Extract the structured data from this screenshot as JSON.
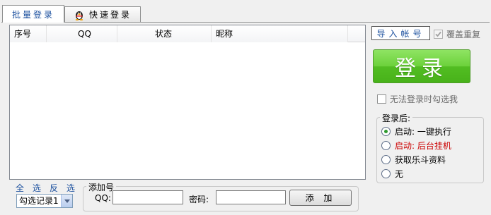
{
  "tabs": [
    {
      "label": "批量登录",
      "active": true
    },
    {
      "label": "快速登录",
      "active": false,
      "icon": "qq-penguin-icon"
    }
  ],
  "list": {
    "columns": [
      "序号",
      "QQ",
      "状态",
      "昵称"
    ]
  },
  "select": {
    "all_label": "全 选",
    "invert_label": "反 选",
    "combo_value": "勾选记录1"
  },
  "add_group": {
    "title": "添加号",
    "qq_label": "QQ:",
    "password_label": "密码:",
    "qq_value": "",
    "password_value": "",
    "add_button": "添 加"
  },
  "import_button": "导入帐号",
  "overwrite_checkbox": {
    "label": "覆盖重复",
    "checked": true,
    "disabled": true
  },
  "login_button": "登录",
  "fail_checkbox": {
    "label": "无法登录时勾选我",
    "checked": false
  },
  "after_login": {
    "title": "登录后:",
    "options": [
      {
        "label": "启动: 一键执行",
        "selected": true,
        "color": "#000000"
      },
      {
        "label": "启动: 后台挂机",
        "selected": false,
        "color": "#cc0000"
      },
      {
        "label": "获取乐斗资料",
        "selected": false,
        "color": "#000000"
      },
      {
        "label": "无",
        "selected": false,
        "color": "#000000"
      }
    ]
  },
  "colors": {
    "accent_blue": "#1a4f9e",
    "login_green": "#52bd22",
    "warning_red": "#cc0000"
  }
}
